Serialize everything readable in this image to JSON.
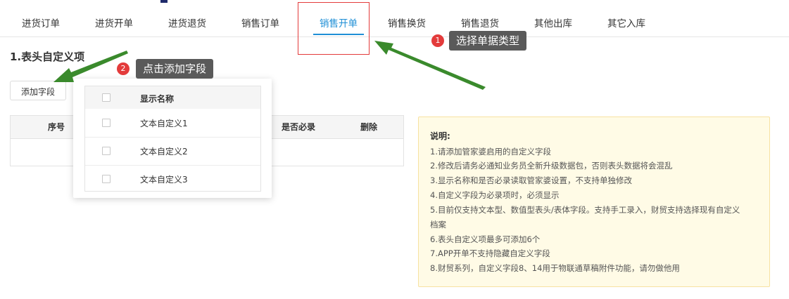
{
  "tabs": [
    {
      "label": "进货订单"
    },
    {
      "label": "进货开单"
    },
    {
      "label": "进货退货"
    },
    {
      "label": "销售订单"
    },
    {
      "label": "销售开单",
      "active": true
    },
    {
      "label": "销售换货"
    },
    {
      "label": "销售退货"
    },
    {
      "label": "其他出库"
    },
    {
      "label": "其它入库"
    }
  ],
  "section": {
    "title": "1.表头自定义项"
  },
  "add_button": {
    "label": "添加字段"
  },
  "table": {
    "headers": {
      "index": "序号",
      "required": "是否必录",
      "delete": "删除"
    }
  },
  "popup": {
    "header": "显示名称",
    "items": [
      "文本自定义1",
      "文本自定义2",
      "文本自定义3"
    ]
  },
  "info": {
    "title": "说明:",
    "lines": [
      "1.请添加管家婆启用的自定义字段",
      "2.修改后请务必通知业务员全新升级数据包，否则表头数据将会混乱",
      "3.显示名称和是否必录读取管家婆设置，不支持单独修改",
      "4.自定义字段为必录项时，必须显示",
      "5.目前仅支持文本型、数值型表头/表体字段。支持手工录入，财贸支持选择现有自定义",
      "档案",
      "6.表头自定义项最多可添加6个",
      "7.APP开单不支持隐藏自定义字段",
      "8.财贸系列，自定义字段8、14用于物联通草稿附件功能，请勿做他用"
    ]
  },
  "callouts": [
    {
      "number": "1",
      "text": "选择单据类型"
    },
    {
      "number": "2",
      "text": "点击添加字段"
    }
  ],
  "colors": {
    "accent": "#1f8fd6",
    "highlight": "#e33b3b",
    "arrow": "#3a8a2c",
    "note_bg": "#fffbe6"
  }
}
